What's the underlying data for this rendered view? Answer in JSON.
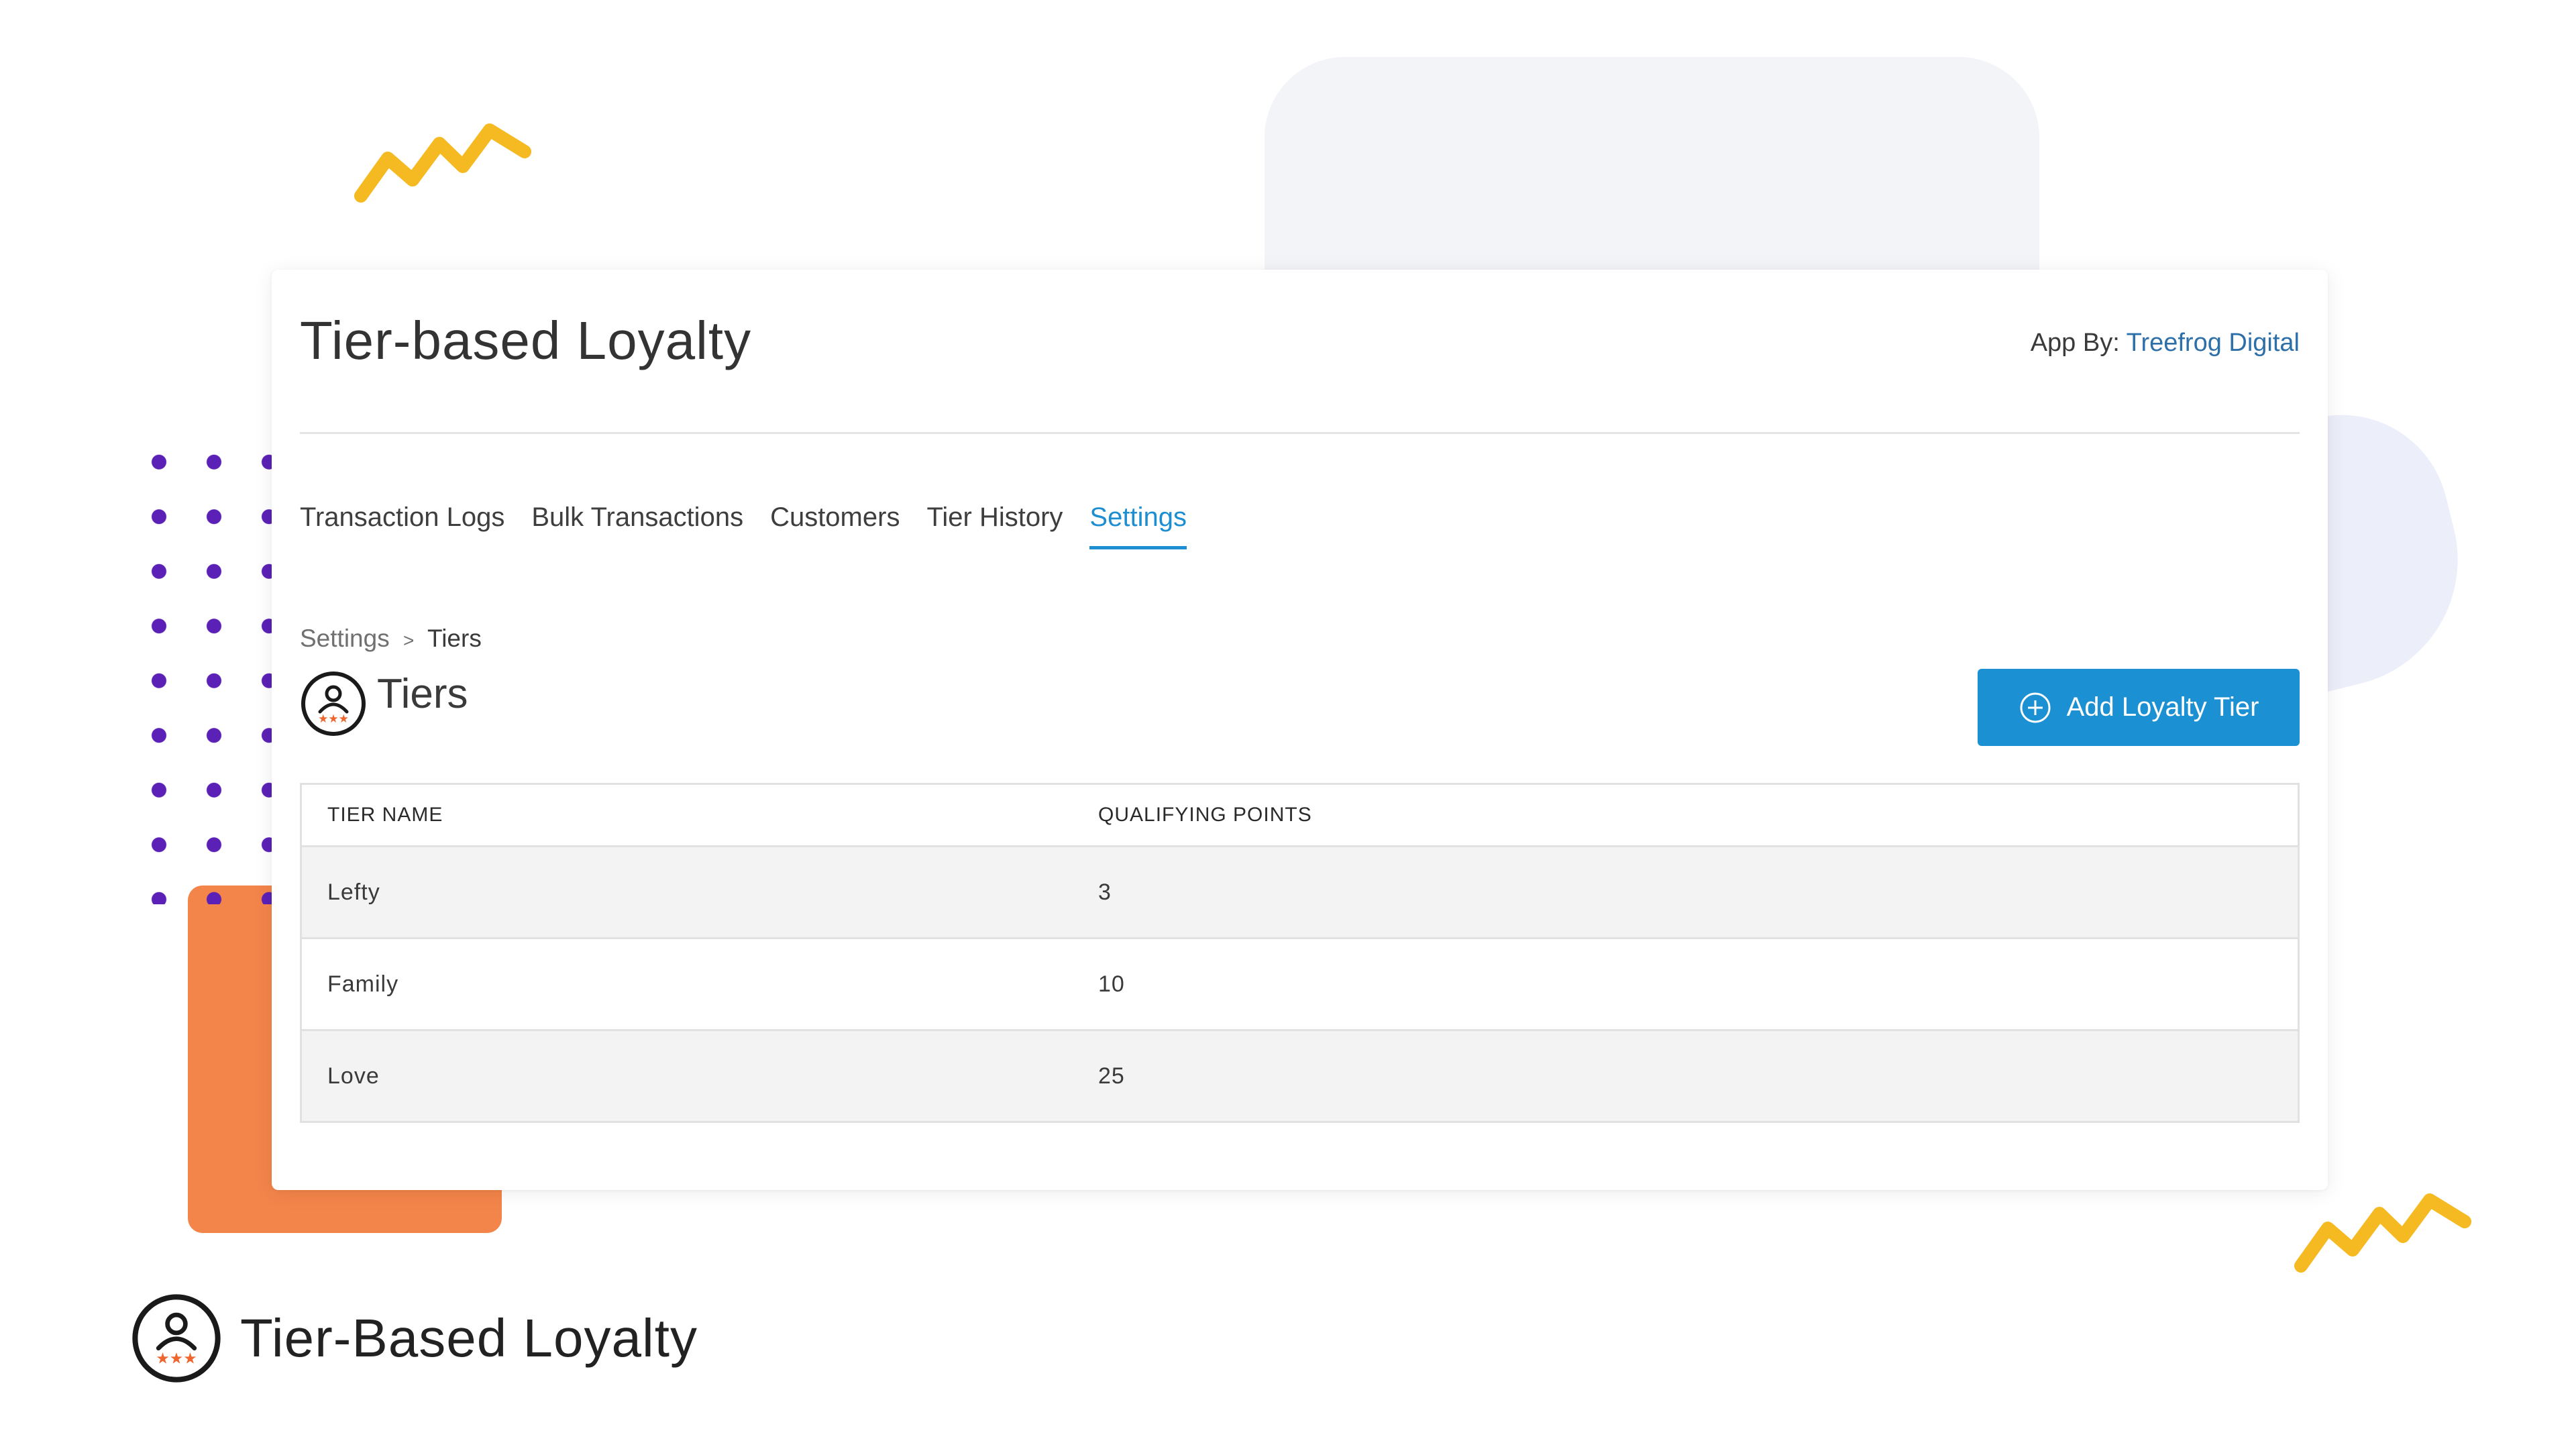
{
  "app": {
    "title": "Tier-based Loyalty",
    "app_by_label": "App By:",
    "vendor_name": "Treefrog Digital"
  },
  "tabs": [
    {
      "label": "Transaction Logs",
      "active": false
    },
    {
      "label": "Bulk Transactions",
      "active": false
    },
    {
      "label": "Customers",
      "active": false
    },
    {
      "label": "Tier History",
      "active": false
    },
    {
      "label": "Settings",
      "active": true
    }
  ],
  "breadcrumb": {
    "parent": "Settings",
    "separator": ">",
    "current": "Tiers"
  },
  "section": {
    "title": "Tiers",
    "icon": "user-stars-icon"
  },
  "actions": {
    "add_tier_label": "Add Loyalty Tier",
    "add_tier_icon": "plus-circle-icon"
  },
  "table": {
    "columns": [
      "TIER NAME",
      "QUALIFYING POINTS"
    ],
    "rows": [
      {
        "name": "Lefty",
        "points": "3"
      },
      {
        "name": "Family",
        "points": "10"
      },
      {
        "name": "Love",
        "points": "25"
      }
    ]
  },
  "brand": {
    "name": "Tier-Based Loyalty",
    "icon": "user-stars-icon"
  },
  "colors": {
    "accent": "#1b90d3",
    "link": "#2d6fa8",
    "star": "#f0642d",
    "decor_orange": "#f3854a",
    "decor_yellow": "#f5b921",
    "decor_dots": "#5b21b6"
  }
}
